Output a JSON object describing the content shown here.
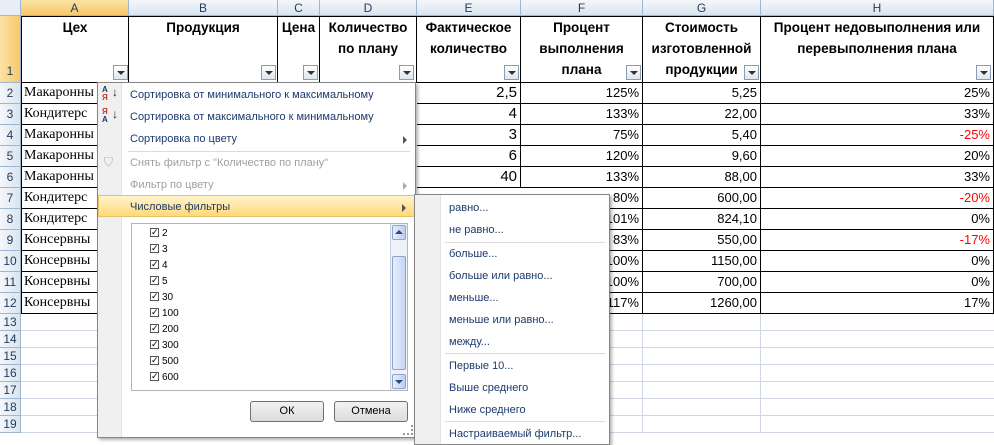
{
  "columns": [
    "A",
    "B",
    "C",
    "D",
    "E",
    "F",
    "G",
    "H"
  ],
  "rows": [
    "1",
    "2",
    "3",
    "4",
    "5",
    "6",
    "7",
    "8",
    "9",
    "10",
    "11",
    "12",
    "13",
    "14",
    "15",
    "16",
    "17",
    "18",
    "19"
  ],
  "headers": {
    "a": "Цех",
    "b": "Продукция",
    "c": "Цена",
    "d": "Количество по плану",
    "e": "Фактическое количество",
    "f": "Процент выполнения плана",
    "g": "Стоимость изготовленной продукции",
    "h": "Процент недовыполнения или перевыполнения плана"
  },
  "col_a": [
    "Макаронны",
    "Кондитерс",
    "Макаронны",
    "Макаронны",
    "Макаронны",
    "Кондитерс",
    "Кондитерс",
    "Консервны",
    "Консервны",
    "Консервны",
    "Консервны"
  ],
  "col_e": [
    "2,5",
    "4",
    "3",
    "6",
    "40"
  ],
  "col_f": [
    "125%",
    "133%",
    "75%",
    "120%",
    "133%",
    "80%",
    "101%",
    "83%",
    "100%",
    "100%",
    "117%"
  ],
  "col_g": [
    "5,25",
    "22,00",
    "5,40",
    "9,60",
    "88,00",
    "600,00",
    "824,10",
    "550,00",
    "1150,00",
    "700,00",
    "1260,00"
  ],
  "col_h": [
    "25%",
    "33%",
    "-25%",
    "20%",
    "33%",
    "-20%",
    "0%",
    "-17%",
    "0%",
    "0%",
    "17%"
  ],
  "colors": {
    "negative": "#ff0000",
    "highlight": "#ffd97a",
    "header_selected": "#f7c86a"
  },
  "menu": {
    "sort_asc": "Сортировка от минимального к максимальному",
    "sort_desc": "Сортировка от максимального к минимальному",
    "sort_color": "Сортировка по цвету",
    "clear_filter": "Снять фильтр с \"Количество по плану\"",
    "filter_color": "Фильтр по цвету",
    "number_filters": "Числовые фильтры",
    "list": [
      "2",
      "3",
      "4",
      "5",
      "30",
      "100",
      "200",
      "300",
      "500",
      "600"
    ],
    "ok": "ОК",
    "cancel": "Отмена",
    "sort_icon_asc_top": "А",
    "sort_icon_asc_bottom": "Я",
    "sort_icon_desc_top": "Я",
    "sort_icon_desc_bottom": "А"
  },
  "submenu": {
    "equals": "равно...",
    "not_equals": "не равно...",
    "greater": "больше...",
    "greater_eq": "больше или равно...",
    "less": "меньше...",
    "less_eq": "меньше или равно...",
    "between": "между...",
    "top10": "Первые 10...",
    "above_avg": "Выше среднего",
    "below_avg": "Ниже среднего",
    "custom": "Настраиваемый фильтр..."
  }
}
